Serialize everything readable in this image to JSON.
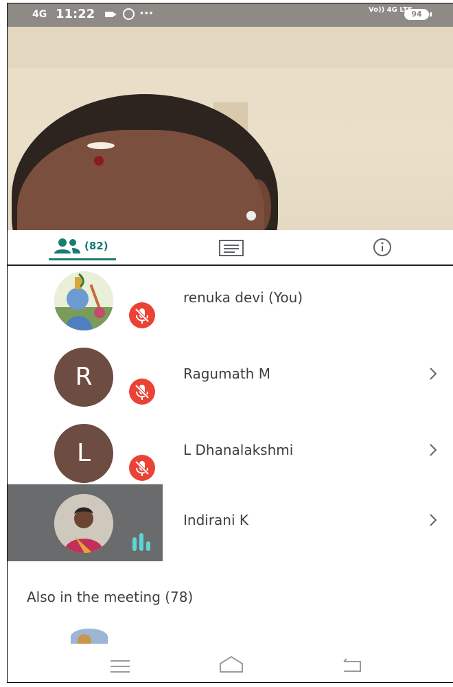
{
  "status_bar": {
    "signal": "4G",
    "time": "11:22",
    "more": "···",
    "network": "Vo)) 4G LTE",
    "battery": "94"
  },
  "tabs": {
    "people_count": "(82)"
  },
  "participants": [
    {
      "name": "renuka devi (You)",
      "avatar": "krishna-picture",
      "muted": true,
      "has_arrow": false
    },
    {
      "name": "Ragumath M",
      "initial": "R",
      "muted": true,
      "has_arrow": true
    },
    {
      "name": "L Dhanalakshmi",
      "initial": "L",
      "muted": true,
      "has_arrow": true
    },
    {
      "name": "Indirani K",
      "avatar": "photo",
      "speaking": true,
      "has_arrow": true
    }
  ],
  "also_in_meeting": "Also in the meeting (78)",
  "colors": {
    "accent": "#1a7a74",
    "mute_red": "#ea4335",
    "avatar_brown": "#6d4c41",
    "speaking_cyan": "#5fd3d6"
  }
}
